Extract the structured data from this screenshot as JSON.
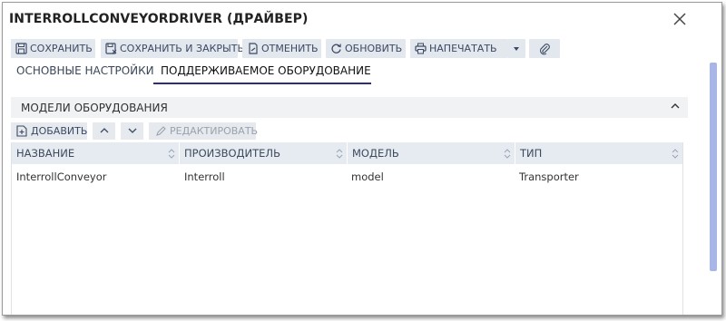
{
  "window": {
    "title": "INTERROLLCONVEYORDRIVER (ДРАЙВЕР)"
  },
  "toolbar": {
    "save_label": "СОХРАНИТЬ",
    "save_close_label": "СОХРАНИТЬ И ЗАКРЫТЬ",
    "cancel_label": "ОТМЕНИТЬ",
    "refresh_label": "ОБНОВИТЬ",
    "print_label": "НАПЕЧАТАТЬ"
  },
  "tabs": [
    {
      "label": "ОСНОВНЫЕ НАСТРОЙКИ",
      "active": false
    },
    {
      "label": "ПОДДЕРЖИВАЕМОЕ ОБОРУДОВАНИЕ",
      "active": true
    }
  ],
  "section": {
    "title": "МОДЕЛИ ОБОРУДОВАНИЯ"
  },
  "grid_toolbar": {
    "add_label": "ДОБАВИТЬ",
    "edit_label": "РЕДАКТИРОВАТЬ"
  },
  "table": {
    "columns": [
      "НАЗВАНИЕ",
      "ПРОИЗВОДИТЕЛЬ",
      "МОДЕЛЬ",
      "ТИП"
    ],
    "rows": [
      [
        "InterrollConveyor",
        "Interroll",
        "model",
        "Transporter"
      ]
    ]
  },
  "colors": {
    "accent": "#2c2e7a",
    "button_bg": "#e3e7ee",
    "header_bg": "#e6ebf1",
    "scrollbar": "#a7b6e6"
  }
}
